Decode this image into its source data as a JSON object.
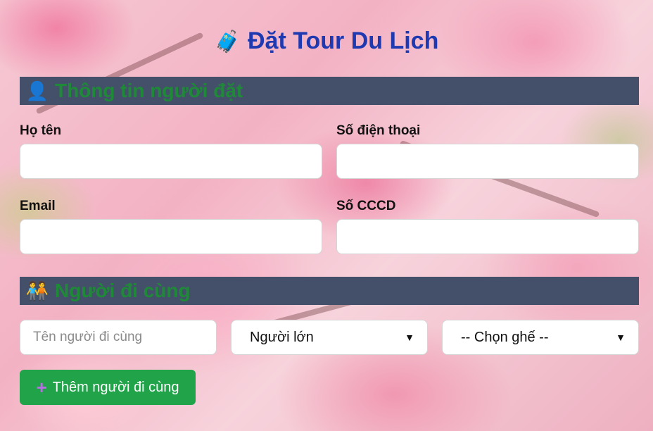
{
  "header": {
    "icon": "🧳",
    "title": "Đặt Tour Du Lịch"
  },
  "booker_section": {
    "icon": "👤",
    "title": "Thông tin người đặt",
    "fields": {
      "name_label": "Họ tên",
      "phone_label": "Số điện thoại",
      "email_label": "Email",
      "id_label": "Số CCCD"
    }
  },
  "companion_section": {
    "icon": "🧑‍🤝‍🧑",
    "title": "Người đi cùng",
    "name_placeholder": "Tên người đi cùng",
    "type_select_value": "Người lớn",
    "seat_select_value": "-- Chọn ghế --",
    "add_button": {
      "icon": "plus-icon",
      "plus_glyph": "+",
      "label": "Thêm người đi cùng"
    }
  },
  "colors": {
    "title": "#1f3ab0",
    "section_bar": "#44506a",
    "section_text": "#1e8a38",
    "add_button": "#21a34a"
  }
}
